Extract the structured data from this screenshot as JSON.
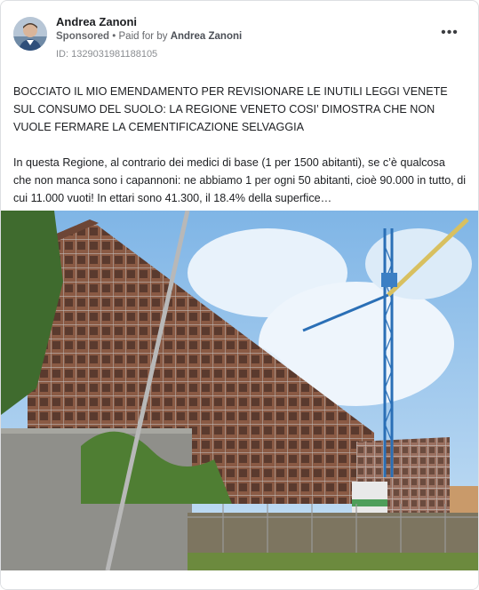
{
  "post": {
    "author": "Andrea Zanoni",
    "sponsored_label": "Sponsored",
    "paid_for_prefix": "Paid for by",
    "paid_for_by": "Andrea Zanoni",
    "ad_id": "ID: 1329031981188105",
    "more_icon": "more-horizontal-icon",
    "headline": "BOCCIATO IL MIO EMENDAMENTO PER REVISIONARE LE INUTILI LEGGI VENETE SUL CONSUMO DEL SUOLO: LA REGIONE VENETO COSI’ DIMOSTRA CHE NON VUOLE FERMARE LA CEMENTIFICAZIONE SELVAGGIA",
    "body": "In questa Regione, al contrario dei medici di base (1 per 1500 abitanti), se c’è qualcosa che non manca sono i capannoni: ne abbiamo 1 per ogni 50 abitanti, cioè 90.000 in tutto, di cui 11.000 vuoti! In ettari sono 41.300, il 18.4% della superfice…"
  },
  "colors": {
    "text_primary": "#1c1e21",
    "text_secondary": "#65676b",
    "crane": "#2a6fb6",
    "crane_jib": "#d8c060",
    "sky": "#9cc7ee"
  }
}
